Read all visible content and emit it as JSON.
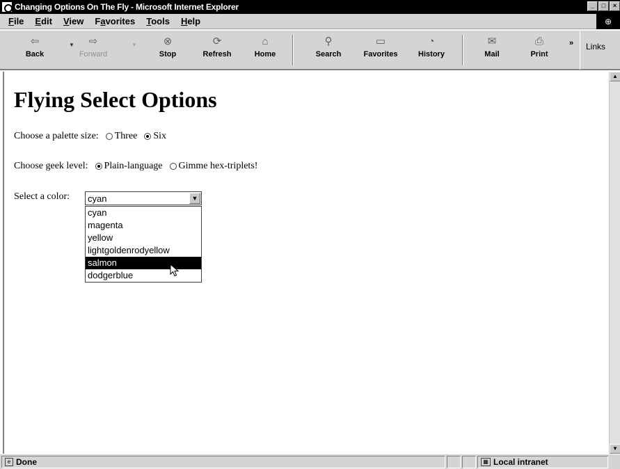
{
  "window": {
    "title": "Changing Options On The Fly - Microsoft Internet Explorer",
    "icon": "ie-page-icon"
  },
  "menu": [
    {
      "label": "File",
      "accel": "F"
    },
    {
      "label": "Edit",
      "accel": "E"
    },
    {
      "label": "View",
      "accel": "V"
    },
    {
      "label": "Favorites",
      "accel": "a"
    },
    {
      "label": "Tools",
      "accel": "T"
    },
    {
      "label": "Help",
      "accel": "H"
    }
  ],
  "toolbar": {
    "back": "Back",
    "forward": "Forward",
    "stop": "Stop",
    "refresh": "Refresh",
    "home": "Home",
    "search": "Search",
    "favorites": "Favorites",
    "history": "History",
    "mail": "Mail",
    "print": "Print",
    "links": "Links"
  },
  "page": {
    "heading": "Flying Select Options",
    "palette": {
      "label": "Choose a palette size:",
      "options": [
        "Three",
        "Six"
      ],
      "selected": "Six"
    },
    "geek": {
      "label": "Choose geek level:",
      "options": [
        "Plain-language",
        "Gimme hex-triplets!"
      ],
      "selected": "Plain-language"
    },
    "color": {
      "label": "Select a color:",
      "value": "cyan",
      "options": [
        "cyan",
        "magenta",
        "yellow",
        "lightgoldenrodyellow",
        "salmon",
        "dodgerblue"
      ],
      "highlighted": "salmon"
    }
  },
  "status": {
    "text": "Done",
    "zone": "Local intranet"
  }
}
